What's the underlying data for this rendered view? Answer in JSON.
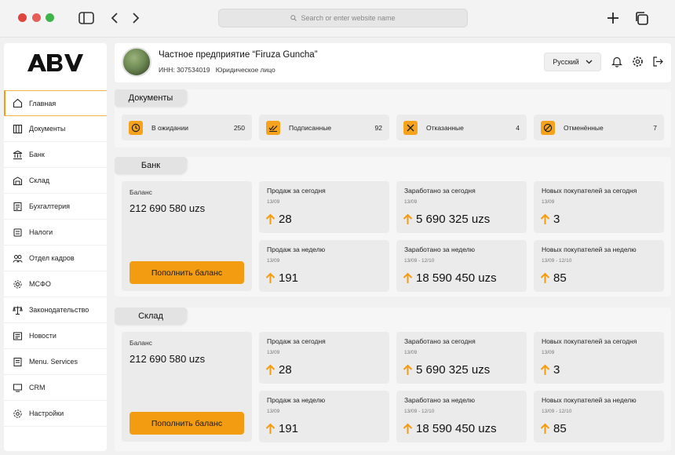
{
  "browser": {
    "url_placeholder": "Search or enter website name"
  },
  "sidebar": {
    "logo_text": "ABV",
    "items": [
      {
        "label": "Главная",
        "icon": "home-icon"
      },
      {
        "label": "Документы",
        "icon": "documents-icon"
      },
      {
        "label": "Банк",
        "icon": "bank-icon"
      },
      {
        "label": "Склад",
        "icon": "warehouse-icon"
      },
      {
        "label": "Бухгалтерия",
        "icon": "accounting-icon"
      },
      {
        "label": "Налоги",
        "icon": "taxes-icon"
      },
      {
        "label": "Отдел кадров",
        "icon": "hr-icon"
      },
      {
        "label": "МСФО",
        "icon": "gear-icon"
      },
      {
        "label": "Законодательство",
        "icon": "scales-icon"
      },
      {
        "label": "Новости",
        "icon": "news-icon"
      },
      {
        "label": "Menu. Services",
        "icon": "services-icon"
      },
      {
        "label": "CRM",
        "icon": "crm-icon"
      },
      {
        "label": "Настройки",
        "icon": "settings-icon"
      }
    ]
  },
  "header": {
    "company_name": "Частное предприятие “Firuza Guncha”",
    "inn": "ИНН: 307534019",
    "entity_type": "Юридическое лицо",
    "language": "Русский"
  },
  "documents": {
    "title": "Документы",
    "cards": [
      {
        "label": "В ожидании",
        "count": "250",
        "icon": "clock-icon"
      },
      {
        "label": "Подписанные",
        "count": "92",
        "icon": "check-icon"
      },
      {
        "label": "Отказанные",
        "count": "4",
        "icon": "cross-icon"
      },
      {
        "label": "Отменённые",
        "count": "7",
        "icon": "cancel-icon"
      }
    ]
  },
  "bank": {
    "title": "Банк",
    "balance_label": "Баланс",
    "balance_value": "212 690 580 uzs",
    "topup_button": "Пополнить баланс",
    "stats": [
      {
        "title": "Продаж за сегодня",
        "date": "13/09",
        "value": "28"
      },
      {
        "title": "Заработано за сегодня",
        "date": "13/09",
        "value": "5 690 325 uzs"
      },
      {
        "title": "Новых покупателей за сегодня",
        "date": "13/09",
        "value": "3"
      },
      {
        "title": "Продаж за неделю",
        "date": "13/09",
        "value": "191"
      },
      {
        "title": "Заработано за неделю",
        "date": "13/09 - 12/10",
        "value": "18 590 450 uzs"
      },
      {
        "title": "Новых покупателей за неделю",
        "date": "13/09 - 12/10",
        "value": "85"
      }
    ]
  },
  "warehouse": {
    "title": "Склад",
    "balance_label": "Баланс",
    "balance_value": "212 690 580 uzs",
    "topup_button": "Пополнить баланс",
    "stats": [
      {
        "title": "Продаж за сегодня",
        "date": "13/09",
        "value": "28"
      },
      {
        "title": "Заработано за сегодня",
        "date": "13/09",
        "value": "5 690 325 uzs"
      },
      {
        "title": "Новых покупателей за сегодня",
        "date": "13/09",
        "value": "3"
      },
      {
        "title": "Продаж за неделю",
        "date": "13/09",
        "value": "191"
      },
      {
        "title": "Заработано за неделю",
        "date": "13/09 - 12/10",
        "value": "18 590 450 uzs"
      },
      {
        "title": "Новых покупателей за неделю",
        "date": "13/09 - 12/10",
        "value": "85"
      }
    ]
  },
  "colors": {
    "accent": "#f39c12",
    "card_bg": "#ebebeb",
    "page_bg": "#f1f1f1"
  }
}
